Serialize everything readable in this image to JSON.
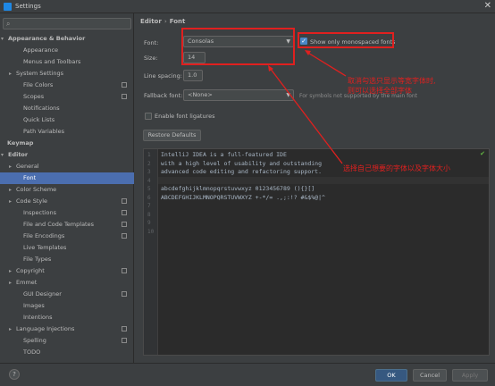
{
  "window": {
    "title": "Settings",
    "icon": "intellij-icon",
    "close_glyph": "✕"
  },
  "search": {
    "icon": "search-icon"
  },
  "sidebar": {
    "items": [
      {
        "label": "Appearance & Behavior",
        "level": 0,
        "arrow": "▾",
        "bold": true
      },
      {
        "label": "Appearance",
        "level": 2
      },
      {
        "label": "Menus and Toolbars",
        "level": 2
      },
      {
        "label": "System Settings",
        "level": 1,
        "arrow": "▸"
      },
      {
        "label": "File Colors",
        "level": 2,
        "project": true
      },
      {
        "label": "Scopes",
        "level": 2,
        "project": true
      },
      {
        "label": "Notifications",
        "level": 2
      },
      {
        "label": "Quick Lists",
        "level": 2
      },
      {
        "label": "Path Variables",
        "level": 2
      },
      {
        "label": "Keymap",
        "level": 0,
        "bold": true
      },
      {
        "label": "Editor",
        "level": 0,
        "arrow": "▾",
        "bold": true
      },
      {
        "label": "General",
        "level": 1,
        "arrow": "▸"
      },
      {
        "label": "Font",
        "level": 2,
        "selected": true
      },
      {
        "label": "Color Scheme",
        "level": 1,
        "arrow": "▸"
      },
      {
        "label": "Code Style",
        "level": 1,
        "arrow": "▸",
        "project": true
      },
      {
        "label": "Inspections",
        "level": 2,
        "project": true
      },
      {
        "label": "File and Code Templates",
        "level": 2,
        "project": true
      },
      {
        "label": "File Encodings",
        "level": 2,
        "project": true
      },
      {
        "label": "Live Templates",
        "level": 2
      },
      {
        "label": "File Types",
        "level": 2
      },
      {
        "label": "Copyright",
        "level": 1,
        "arrow": "▸",
        "project": true
      },
      {
        "label": "Emmet",
        "level": 1,
        "arrow": "▸"
      },
      {
        "label": "GUI Designer",
        "level": 2,
        "project": true
      },
      {
        "label": "Images",
        "level": 2
      },
      {
        "label": "Intentions",
        "level": 2
      },
      {
        "label": "Language Injections",
        "level": 1,
        "arrow": "▸",
        "project": true
      },
      {
        "label": "Spelling",
        "level": 2,
        "project": true
      },
      {
        "label": "TODO",
        "level": 2
      }
    ]
  },
  "breadcrumb": {
    "parent": "Editor",
    "separator": "›",
    "current": "Font"
  },
  "font_settings": {
    "font_label": "Font:",
    "font_value": "Consolas",
    "monospaced_checked": true,
    "monospaced_label": "Show only monospaced fonts",
    "size_label": "Size:",
    "size_value": "14",
    "line_spacing_label": "Line spacing:",
    "line_spacing_value": "1.0",
    "fallback_label": "Fallback font:",
    "fallback_value": "<None>",
    "fallback_hint": "For symbols not supported by the main font",
    "ligatures_checked": false,
    "ligatures_label": "Enable font ligatures",
    "restore_label": "Restore Defaults"
  },
  "preview": {
    "line_numbers": [
      "1",
      "2",
      "3",
      "4",
      "5",
      "6",
      "7",
      "8",
      "9",
      "10"
    ],
    "lines": [
      "IntelliJ IDEA is a full-featured IDE",
      "with a high level of usability and outstanding",
      "advanced code editing and refactoring support.",
      "",
      "abcdefghijklmnopqrstuvwxyz 0123456789 (){}[]",
      "ABCDEFGHIJKLMNOPQRSTUVWXYZ +-*/= .,;:!? #&$%@|^",
      "",
      "",
      "",
      ""
    ],
    "status_icon": "check-icon",
    "status_glyph": "✔"
  },
  "annotations": {
    "note1_line1": "取消勾选只显示等宽字体时,",
    "note1_line2": "则可以选择全部字体",
    "note2": "选择自己想要的字体以及字体大小",
    "color": "#e0201f"
  },
  "footer": {
    "help_label": "?",
    "ok_label": "OK",
    "cancel_label": "Cancel",
    "apply_label": "Apply"
  },
  "colors": {
    "accent": "#4b6eaf",
    "ok_button": "#365880",
    "annotation": "#e0201f"
  }
}
